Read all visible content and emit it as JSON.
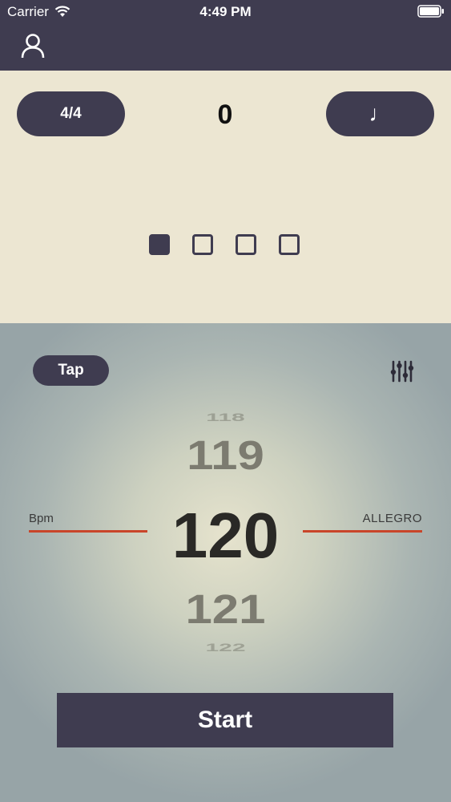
{
  "status_bar": {
    "carrier": "Carrier",
    "time": "4:49 PM"
  },
  "header": {
    "profile_icon": "person-icon"
  },
  "meter": {
    "time_signature": "4/4",
    "beat_count": "0",
    "note_value": "♩",
    "beats_total": 4,
    "active_beat": 1
  },
  "controls": {
    "tap_label": "Tap",
    "settings_icon": "sliders-icon"
  },
  "tempo": {
    "values": [
      "118",
      "119",
      "120",
      "121",
      "122"
    ],
    "selected": "120",
    "unit_label": "Bpm",
    "marking": "ALLEGRO"
  },
  "start_label": "Start",
  "colors": {
    "dark": "#3f3c50",
    "beige": "#ece6d2",
    "accent_red": "#c9452a"
  }
}
